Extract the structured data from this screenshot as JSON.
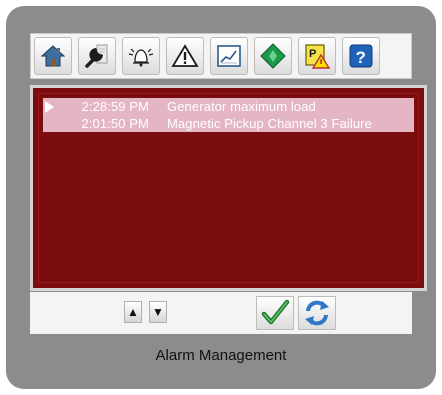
{
  "toolbar": {
    "buttons": [
      {
        "id": "home",
        "icon": "house-icon"
      },
      {
        "id": "settings",
        "icon": "wrench-icon"
      },
      {
        "id": "alarms",
        "icon": "alarm-bell-icon"
      },
      {
        "id": "warnings",
        "icon": "warning-triangle-icon"
      },
      {
        "id": "trends",
        "icon": "trend-chart-icon"
      },
      {
        "id": "status",
        "icon": "green-diamond-icon"
      },
      {
        "id": "param-alarm",
        "icon": "parameter-alarm-icon",
        "label": "P"
      },
      {
        "id": "help",
        "icon": "help-icon",
        "label": "?"
      }
    ]
  },
  "alarms": [
    {
      "time": "2:28:59 PM",
      "message": "Generator maximum load",
      "selected": true
    },
    {
      "time": "2:01:50 PM",
      "message": "Magnetic Pickup Channel 3 Failure",
      "selected": false
    }
  ],
  "controls": {
    "up_label": "▲",
    "down_label": "▼",
    "acknowledge_icon": "checkmark-icon",
    "reset_icon": "reset-arrows-icon"
  },
  "caption": "Alarm Management",
  "colors": {
    "frame": "#8c8c8c",
    "alarm_background": "#7a0d0d",
    "alarm_row_highlight": "#e4b6c3",
    "text_on_alarm": "#ffffff"
  }
}
